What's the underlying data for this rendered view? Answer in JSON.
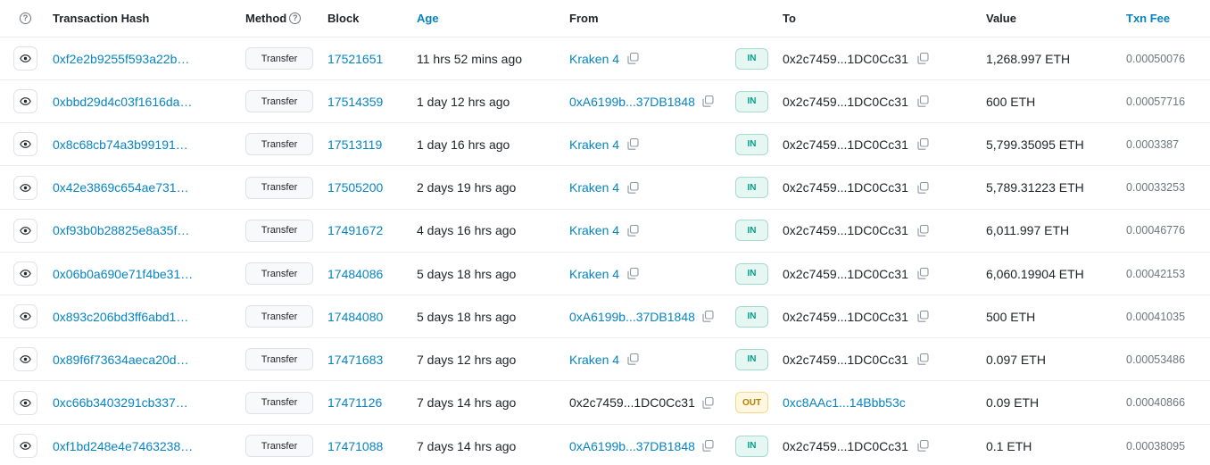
{
  "headers": {
    "help_icon": "question-circle-icon",
    "hash": "Transaction Hash",
    "method": "Method",
    "block": "Block",
    "age": "Age",
    "from": "From",
    "to": "To",
    "value": "Value",
    "fee": "Txn Fee"
  },
  "colors": {
    "link": "#0784c3",
    "in_badge_bg": "#e6f6f2",
    "in_badge_text": "#00a186",
    "out_badge_bg": "#fff7e0",
    "out_badge_text": "#b47d00",
    "border": "#e9ecef"
  },
  "rows": [
    {
      "hash": "0xf2e2b9255f593a22b…",
      "method": "Transfer",
      "block": "17521651",
      "age": "11 hrs 52 mins ago",
      "from": "Kraken 4",
      "from_is_link": true,
      "direction": "IN",
      "to": "0x2c7459...1DC0Cc31",
      "to_is_link": false,
      "value": "1,268.997 ETH",
      "fee": "0.00050076"
    },
    {
      "hash": "0xbbd29d4c03f1616da…",
      "method": "Transfer",
      "block": "17514359",
      "age": "1 day 12 hrs ago",
      "from": "0xA6199b...37DB1848",
      "from_is_link": true,
      "direction": "IN",
      "to": "0x2c7459...1DC0Cc31",
      "to_is_link": false,
      "value": "600 ETH",
      "fee": "0.00057716"
    },
    {
      "hash": "0x8c68cb74a3b99191…",
      "method": "Transfer",
      "block": "17513119",
      "age": "1 day 16 hrs ago",
      "from": "Kraken 4",
      "from_is_link": true,
      "direction": "IN",
      "to": "0x2c7459...1DC0Cc31",
      "to_is_link": false,
      "value": "5,799.35095 ETH",
      "fee": "0.0003387"
    },
    {
      "hash": "0x42e3869c654ae731…",
      "method": "Transfer",
      "block": "17505200",
      "age": "2 days 19 hrs ago",
      "from": "Kraken 4",
      "from_is_link": true,
      "direction": "IN",
      "to": "0x2c7459...1DC0Cc31",
      "to_is_link": false,
      "value": "5,789.31223 ETH",
      "fee": "0.00033253"
    },
    {
      "hash": "0xf93b0b28825e8a35f…",
      "method": "Transfer",
      "block": "17491672",
      "age": "4 days 16 hrs ago",
      "from": "Kraken 4",
      "from_is_link": true,
      "direction": "IN",
      "to": "0x2c7459...1DC0Cc31",
      "to_is_link": false,
      "value": "6,011.997 ETH",
      "fee": "0.00046776"
    },
    {
      "hash": "0x06b0a690e71f4be31…",
      "method": "Transfer",
      "block": "17484086",
      "age": "5 days 18 hrs ago",
      "from": "Kraken 4",
      "from_is_link": true,
      "direction": "IN",
      "to": "0x2c7459...1DC0Cc31",
      "to_is_link": false,
      "value": "6,060.19904 ETH",
      "fee": "0.00042153"
    },
    {
      "hash": "0x893c206bd3ff6abd1…",
      "method": "Transfer",
      "block": "17484080",
      "age": "5 days 18 hrs ago",
      "from": "0xA6199b...37DB1848",
      "from_is_link": true,
      "direction": "IN",
      "to": "0x2c7459...1DC0Cc31",
      "to_is_link": false,
      "value": "500 ETH",
      "fee": "0.00041035"
    },
    {
      "hash": "0x89f6f73634aeca20d…",
      "method": "Transfer",
      "block": "17471683",
      "age": "7 days 12 hrs ago",
      "from": "Kraken 4",
      "from_is_link": true,
      "direction": "IN",
      "to": "0x2c7459...1DC0Cc31",
      "to_is_link": false,
      "value": "0.097 ETH",
      "fee": "0.00053486"
    },
    {
      "hash": "0xc66b3403291cb337…",
      "method": "Transfer",
      "block": "17471126",
      "age": "7 days 14 hrs ago",
      "from": "0x2c7459...1DC0Cc31",
      "from_is_link": false,
      "direction": "OUT",
      "to": "0xc8AAc1...14Bbb53c",
      "to_is_link": true,
      "value": "0.09 ETH",
      "fee": "0.00040866"
    },
    {
      "hash": "0xf1bd248e4e7463238…",
      "method": "Transfer",
      "block": "17471088",
      "age": "7 days 14 hrs ago",
      "from": "0xA6199b...37DB1848",
      "from_is_link": true,
      "direction": "IN",
      "to": "0x2c7459...1DC0Cc31",
      "to_is_link": false,
      "value": "0.1 ETH",
      "fee": "0.00038095"
    }
  ]
}
